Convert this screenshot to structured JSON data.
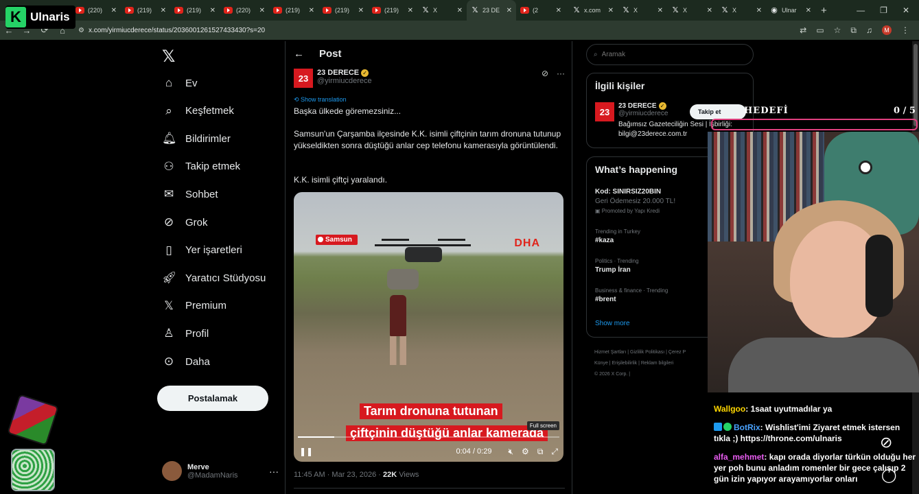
{
  "browser": {
    "tabs": [
      {
        "label": "(220)",
        "icon": "youtube-icon",
        "active": false
      },
      {
        "label": "(219)",
        "icon": "youtube-icon",
        "active": false
      },
      {
        "label": "(219)",
        "icon": "youtube-icon",
        "active": false
      },
      {
        "label": "(220)",
        "icon": "youtube-icon",
        "active": false
      },
      {
        "label": "(219)",
        "icon": "youtube-icon",
        "active": false
      },
      {
        "label": "(219)",
        "icon": "youtube-icon",
        "active": false
      },
      {
        "label": "(219)",
        "icon": "youtube-icon",
        "active": false
      },
      {
        "label": "X",
        "icon": "x-icon",
        "active": false
      },
      {
        "label": "23 DE",
        "icon": "x-icon",
        "active": true
      },
      {
        "label": "(2",
        "icon": "youtube-icon",
        "active": false
      },
      {
        "label": "x.com",
        "icon": "x-icon",
        "active": false
      },
      {
        "label": "X",
        "icon": "x-icon",
        "active": false
      },
      {
        "label": "X",
        "icon": "x-icon",
        "active": false
      },
      {
        "label": "X",
        "icon": "x-icon",
        "active": false
      },
      {
        "label": "Ulnar",
        "icon": "globe-icon",
        "active": false
      }
    ],
    "url": "x.com/yirmiucderece/status/2036001261527433430?s=20",
    "profile_initial": "M"
  },
  "overlay": {
    "channel_name": "Ulnaris",
    "channel_logo": "K",
    "goal_label": "HEDEFİ",
    "goal_count": "0  /  5",
    "chat": [
      {
        "user": "Wallgoo",
        "text": "1saat uyutmadılar ya",
        "color": "#ffd700"
      },
      {
        "user": "BotRix",
        "text": "Wishlist'imi Ziyaret etmek istersen tıkla ;) https://throne.com/ulnaris",
        "color": "#4aa3ff"
      },
      {
        "user": "alfa_mehmet",
        "text": "kapı orada diyorlar türkün olduğu her yer poh bunu anladım romenler bir gece çalışıp 2 gün izin yapıyor arayamıyorlar onları",
        "color": "#e85cf0"
      }
    ]
  },
  "nav": {
    "items": [
      {
        "label": "Ev",
        "icon": "home-icon"
      },
      {
        "label": "Keşfetmek",
        "icon": "search-icon"
      },
      {
        "label": "Bildirimler",
        "icon": "bell-icon"
      },
      {
        "label": "Takip etmek",
        "icon": "add-person-icon"
      },
      {
        "label": "Sohbet",
        "icon": "mail-icon"
      },
      {
        "label": "Grok",
        "icon": "grok-icon"
      },
      {
        "label": "Yer işaretleri",
        "icon": "bookmark-icon"
      },
      {
        "label": "Yaratıcı Stüdyosu",
        "icon": "rocket-icon"
      },
      {
        "label": "Premium",
        "icon": "x-icon"
      },
      {
        "label": "Profil",
        "icon": "person-icon"
      },
      {
        "label": "Daha",
        "icon": "more-icon"
      }
    ],
    "post_button": "Postalamak",
    "account": {
      "name": "Merve",
      "handle": "@MadamNaris"
    }
  },
  "post": {
    "header": "Post",
    "author": {
      "name": "23 DERECE",
      "handle": "@yirmiucderece",
      "logo": "23"
    },
    "show_translation": "Show translation",
    "paragraphs": [
      "Başka ülkede göremezsiniz...",
      "Samsun'un Çarşamba ilçesinde K.K. isimli çiftçinin tarım dronuna tutunup yükseldikten sonra düştüğü anlar cep telefonu kamerasıyla görüntülendi.",
      "K.K. isimli çiftçi yaralandı."
    ],
    "video": {
      "location_tag": "Samsun",
      "watermark": "DHA",
      "caption_line1": "Tarım dronuna tutunan",
      "caption_line2": "çiftçinin düştüğü anlar kamerada",
      "fullscreen_tooltip": "Full screen",
      "time": "0:04 / 0:29",
      "progress": 0.138
    },
    "timestamp": "11:45 AM · Mar 23, 2026 · ",
    "views_count": "22K",
    "views_label": " Views"
  },
  "sidebar": {
    "search_placeholder": "Aramak",
    "related_title": "İlgili kişiler",
    "related_user": {
      "name": "23 DERECE",
      "handle": "@yirmiucderece",
      "bio": "Bağımsız Gazeteciliğin Sesi | İşbirliği: bilgi@23derece.com.tr",
      "follow": "Takip et"
    },
    "happening_title": "What’s happening",
    "trends": [
      {
        "title": "Kod: SINIRSIZ20BIN",
        "sub": "Geri Ödemesiz 20.000 TL!",
        "cat": "Promoted by Yapı Kredi"
      },
      {
        "cat": "Trending in Turkey",
        "title": "#kaza"
      },
      {
        "cat": "Politics · Trending",
        "title": "Trump İran"
      },
      {
        "cat": "Business & finance · Trending",
        "title": "#brent"
      }
    ],
    "show_more": "Show more",
    "footer": [
      "Hizmet Şartları",
      "Gizlilik Politikası",
      "Çerez P",
      "Künye",
      "Erişilebilirlik",
      "Reklam bilgileri",
      "© 2026 X Corp."
    ]
  }
}
